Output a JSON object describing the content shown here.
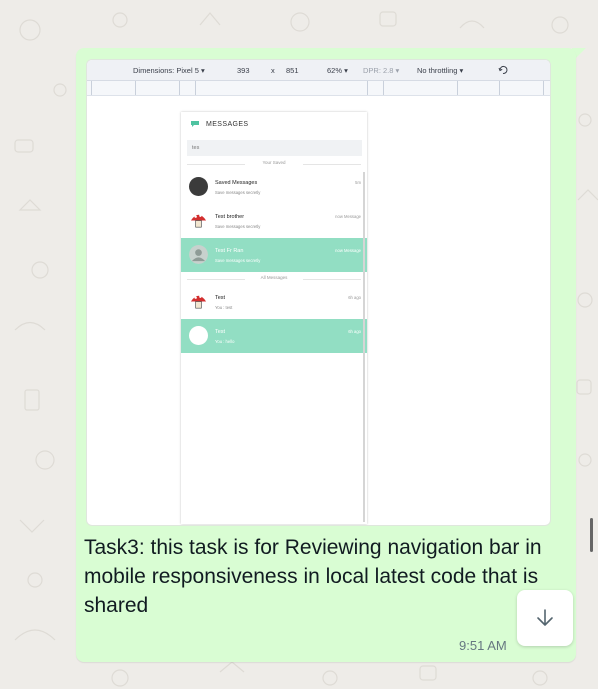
{
  "message": {
    "caption": "Task3: this task is for Reviewing navigation bar in mobile responsiveness in local latest code that is shared",
    "time": "9:51 AM"
  },
  "devtools": {
    "dimensions": "Dimensions: Pixel 5 ▾",
    "width": "393",
    "times": "x",
    "height": "851",
    "zoom": "62% ▾",
    "dpr": "DPR: 2.8 ▾",
    "throttling": "No throttling ▾"
  },
  "phone": {
    "title": "MESSAGES",
    "search_value": "tes",
    "section_your": "Your Saved",
    "section_all": "All Messages",
    "saved": [
      {
        "name": "Saved Messages",
        "sub": "Save messages secretly",
        "time": "5m",
        "selected": false
      },
      {
        "name": "Test brother",
        "sub": "Save messages secretly",
        "time": "now Message",
        "selected": false
      },
      {
        "name": "Test Fr Ran",
        "sub": "Save messages secretly",
        "time": "now Message",
        "selected": true
      }
    ],
    "all": [
      {
        "name": "Test",
        "sub": "You : test",
        "time": "6h ago",
        "selected": false
      },
      {
        "name": "Test",
        "sub": "You : hello",
        "time": "6h ago",
        "selected": true
      }
    ]
  },
  "colors": {
    "bubble": "#d9fdd3",
    "selected_row": "#92dec3"
  },
  "icons": {
    "scroll_down": "arrow-down-icon",
    "rotate": "rotate-icon"
  }
}
